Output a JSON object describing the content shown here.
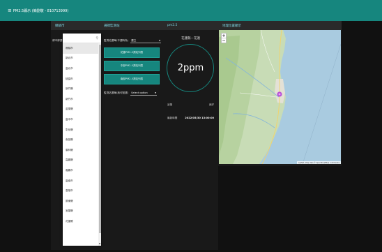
{
  "header": {
    "menu_icon": "≡",
    "title": "PM2.5顯示 (簡劉敬 - 810713999)"
  },
  "left_panel": {
    "header": "鄉鎮市",
    "subheader": "鄉市鄉選單"
  },
  "dropdown": {
    "search_icon": "search-icon",
    "items": [
      "鄉鎮市",
      "新北市",
      "臺北市",
      "桃園市",
      "新竹縣",
      "新竹市",
      "苗栗縣",
      "臺中市",
      "彰化縣",
      "南投縣",
      "雲林縣",
      "嘉義縣",
      "嘉義市",
      "臺南市",
      "高雄市",
      "屏東縣",
      "宜蘭縣",
      "花蓮縣"
    ],
    "selected_index": 0
  },
  "control_panel": {
    "header": "選擇監測站",
    "row1_label": "監測站選單(不選時為)",
    "row1_value": "選立",
    "button1": "花蓮PM2.5測站列表",
    "button2": "中部PM2.5測站列表",
    "button3": "南部PM2.5測站列表",
    "row2_label": "監測站選單(無可點選)",
    "row2_value": "Select option"
  },
  "pm_panel": {
    "header": "pm2.5",
    "station": "花蓮縣－花蓮",
    "value": "2ppm",
    "status_label": "狀態",
    "status_value": "良好",
    "time_label": "最新時間",
    "time_value": "2022/05/30 13:00:00"
  },
  "map_panel": {
    "header": "地理位置顯示",
    "zoom_in": "+",
    "zoom_out": "−",
    "attribution": "Leaflet | Map data © OpenStreetMap contributors"
  },
  "colors": {
    "accent": "#16867e",
    "marker": "#b23bd6"
  }
}
